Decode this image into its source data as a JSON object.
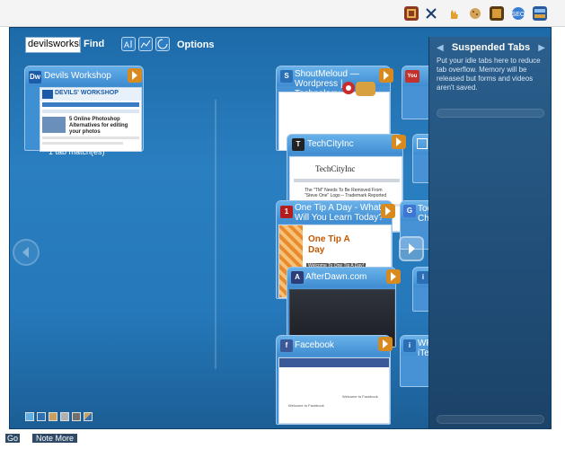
{
  "toolbar": {
    "icons": [
      "extension-icon",
      "close-x-icon",
      "hand-icon",
      "cookie-icon",
      "app-icon",
      "seo-icon",
      "panorama-icon"
    ]
  },
  "find": {
    "input_value": "devilsworkshc",
    "label": "Find",
    "options_label": "Options"
  },
  "group": {
    "match_text": "1 tab match(es)"
  },
  "tabs": [
    {
      "title": "Devils Workshop",
      "favicon_text": "Dw",
      "favicon_color": "#1a5aa6"
    },
    {
      "title": "ShoutMeloud — Wordpress | Technology...",
      "favicon_text": "S",
      "favicon_color": "#2a6fb6"
    },
    {
      "title": "TechCityInc",
      "favicon_text": "T",
      "favicon_color": "#222222"
    },
    {
      "title": "One Tip A Day - What Will You Learn Today?",
      "favicon_text": "1",
      "favicon_color": "#b31d1d"
    },
    {
      "title": "AfterDawn.com",
      "favicon_text": "A",
      "favicon_color": "#2d3d7a"
    },
    {
      "title": "Facebook",
      "favicon_text": "f",
      "favicon_color": "#3b5998"
    },
    {
      "title": "You YouTube",
      "favicon_text": "You",
      "favicon_color": "#c4302b"
    },
    {
      "title": "Too Ch...",
      "favicon_text": "G",
      "favicon_color": "#3f76d6"
    },
    {
      "title": "WF iTe...",
      "favicon_text": "i",
      "favicon_color": "#2a6fb6"
    }
  ],
  "thumb_texts": {
    "dw_brand": "DEVILS' WORKSHOP",
    "dw_article": "5 Online Photoshop Alternatives for editing your photos",
    "tci_brand": "TechCityInc",
    "tci_article": "The \"TM\" Needs To Be Removed From \"Steve One\" Logo – Trademark Reported",
    "otad_brand": "One Tip A Day",
    "otad_article": "Welcome To One Tip A Day!",
    "fb_fields": [
      "Welcome to Facebook",
      "Welcome to Facebook"
    ]
  },
  "suspended": {
    "title": "Suspended Tabs",
    "description": "Put your idle tabs here to reduce tab overflow. Memory will be released but forms and videos aren't saved."
  },
  "swatches": [
    "#5ab0e8",
    "#2f6fb4",
    "#c8a060",
    "#b0b0b0",
    "#707070",
    "#c8a060"
  ],
  "footer": {
    "left": "Go",
    "right": "Note More"
  },
  "colors": {
    "panel_blue": "#2579bb",
    "sidebar_blue": "#204d77",
    "header_blue": "#3f8cd1"
  }
}
